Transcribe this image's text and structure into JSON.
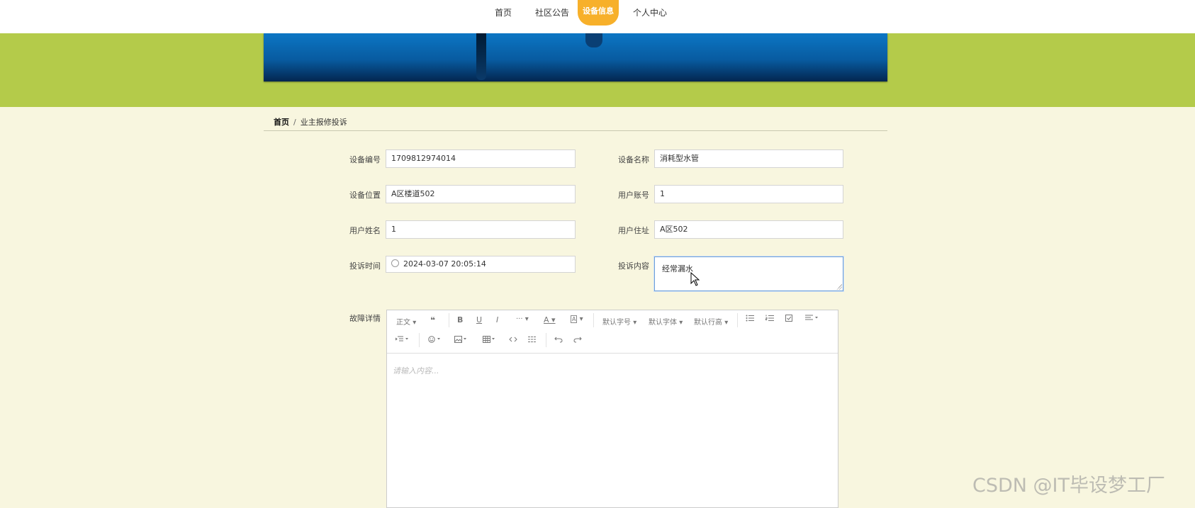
{
  "nav": {
    "items": [
      "首页",
      "社区公告",
      "设备信息",
      "个人中心"
    ]
  },
  "breadcrumb": {
    "home": "首页",
    "separator": "/",
    "current": "业主报修投诉"
  },
  "form": {
    "device_no_label": "设备编号",
    "device_no_value": "1709812974014",
    "device_name_label": "设备名称",
    "device_name_value": "消耗型水管",
    "device_location_label": "设备位置",
    "device_location_value": "A区楼道502",
    "user_account_label": "用户账号",
    "user_account_value": "1",
    "user_name_label": "用户姓名",
    "user_name_value": "1",
    "user_address_label": "用户住址",
    "user_address_value": "A区502",
    "complaint_time_label": "投诉时间",
    "complaint_time_value": "2024-03-07 20:05:14",
    "complaint_content_label": "投诉内容",
    "complaint_content_value": "经常漏水",
    "fault_detail_label": "故障详情"
  },
  "editor": {
    "toolbar": {
      "paragraph": "正文",
      "quote": "❝",
      "bold": "B",
      "underline": "U",
      "italic": "I",
      "more": "···",
      "font_color": "A",
      "bg_color": "A",
      "font_size": "默认字号",
      "font_family": "默认字体",
      "line_height": "默认行高",
      "caret": "▾"
    },
    "placeholder": "请输入内容..."
  },
  "watermark": "CSDN @IT毕设梦工厂",
  "colors": {
    "green_band": "#b4cb4a",
    "page_bg": "#f8f6df",
    "nav_active": "#f7b02a",
    "banner_blue": "#0c76c4"
  }
}
